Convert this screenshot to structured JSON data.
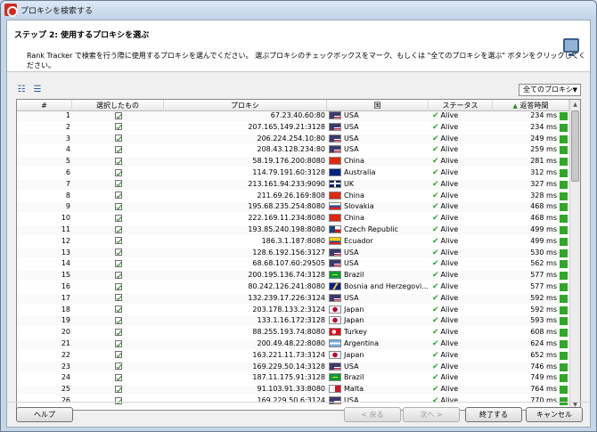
{
  "window": {
    "title": "プロキシを検索する"
  },
  "header": {
    "step_title": "ステップ 2: 使用するプロキシを選ぶ",
    "description": "Rank Tracker で検索を行う際に使用するプロキシを選んでください。 選ぶプロキシのチェックボックスをマーク、もしくは \"全てのプロキシを選ぶ\" ボタンをクリックしてください。"
  },
  "toolbar": {
    "filter_selected": "全てのプロキシ",
    "icons": [
      "select-all-icon",
      "deselect-all-icon"
    ]
  },
  "table": {
    "columns": [
      "#",
      "選択したもの",
      "プロキシ",
      "国",
      "ステータス",
      "返答時間"
    ],
    "sort_column": "返答時間",
    "rows": [
      {
        "num": "1",
        "proxy": "67.23.40.60:80",
        "country": "USA",
        "flag": "us",
        "status": "Alive",
        "resp": "234 ms"
      },
      {
        "num": "2",
        "proxy": "207.165.149.21:3128",
        "country": "USA",
        "flag": "us",
        "status": "Alive",
        "resp": "234 ms"
      },
      {
        "num": "3",
        "proxy": "206.224.254.10:80",
        "country": "USA",
        "flag": "us",
        "status": "Alive",
        "resp": "249 ms"
      },
      {
        "num": "4",
        "proxy": "208.43.128.234:80",
        "country": "USA",
        "flag": "us",
        "status": "Alive",
        "resp": "259 ms"
      },
      {
        "num": "5",
        "proxy": "58.19.176.200:8080",
        "country": "China",
        "flag": "cn",
        "status": "Alive",
        "resp": "281 ms"
      },
      {
        "num": "6",
        "proxy": "114.79.191.60:3128",
        "country": "Australia",
        "flag": "au",
        "status": "Alive",
        "resp": "312 ms"
      },
      {
        "num": "7",
        "proxy": "213.161.94.233:9090",
        "country": "UK",
        "flag": "uk",
        "status": "Alive",
        "resp": "327 ms"
      },
      {
        "num": "8",
        "proxy": "211.69.26.169:808",
        "country": "China",
        "flag": "cn",
        "status": "Alive",
        "resp": "328 ms"
      },
      {
        "num": "9",
        "proxy": "195.68.235.254:8080",
        "country": "Slovakia",
        "flag": "sk",
        "status": "Alive",
        "resp": "468 ms"
      },
      {
        "num": "10",
        "proxy": "222.169.11.234:8080",
        "country": "China",
        "flag": "cn",
        "status": "Alive",
        "resp": "468 ms"
      },
      {
        "num": "11",
        "proxy": "193.85.240.198:8080",
        "country": "Czech Republic",
        "flag": "cz",
        "status": "Alive",
        "resp": "499 ms"
      },
      {
        "num": "12",
        "proxy": "186.3.1.187:8080",
        "country": "Ecuador",
        "flag": "ec",
        "status": "Alive",
        "resp": "499 ms"
      },
      {
        "num": "13",
        "proxy": "128.6.192.156:3127",
        "country": "USA",
        "flag": "us",
        "status": "Alive",
        "resp": "530 ms"
      },
      {
        "num": "14",
        "proxy": "68.68.107.60:29505",
        "country": "USA",
        "flag": "us",
        "status": "Alive",
        "resp": "562 ms"
      },
      {
        "num": "15",
        "proxy": "200.195.136.74:3128",
        "country": "Brazil",
        "flag": "br",
        "status": "Alive",
        "resp": "577 ms"
      },
      {
        "num": "16",
        "proxy": "80.242.126.241:8080",
        "country": "Bosnia and Herzegovi...",
        "flag": "ba",
        "status": "Alive",
        "resp": "577 ms"
      },
      {
        "num": "17",
        "proxy": "132.239.17.226:3124",
        "country": "USA",
        "flag": "us",
        "status": "Alive",
        "resp": "592 ms"
      },
      {
        "num": "18",
        "proxy": "203.178.133.2:3124",
        "country": "Japan",
        "flag": "jp",
        "status": "Alive",
        "resp": "592 ms"
      },
      {
        "num": "19",
        "proxy": "133.1.16.172:3128",
        "country": "Japan",
        "flag": "jp",
        "status": "Alive",
        "resp": "593 ms"
      },
      {
        "num": "20",
        "proxy": "88.255.193.74:8080",
        "country": "Turkey",
        "flag": "tr",
        "status": "Alive",
        "resp": "608 ms"
      },
      {
        "num": "21",
        "proxy": "200.49.48.22:8080",
        "country": "Argentina",
        "flag": "ar",
        "status": "Alive",
        "resp": "624 ms"
      },
      {
        "num": "22",
        "proxy": "163.221.11.73:3124",
        "country": "Japan",
        "flag": "jp",
        "status": "Alive",
        "resp": "652 ms"
      },
      {
        "num": "23",
        "proxy": "169.229.50.14:3128",
        "country": "USA",
        "flag": "us",
        "status": "Alive",
        "resp": "746 ms"
      },
      {
        "num": "24",
        "proxy": "187.11.175.91:3128",
        "country": "Brazil",
        "flag": "br",
        "status": "Alive",
        "resp": "749 ms"
      },
      {
        "num": "25",
        "proxy": "91.103.91.33:8080",
        "country": "Malta",
        "flag": "mt",
        "status": "Alive",
        "resp": "764 ms"
      },
      {
        "num": "26",
        "proxy": "169.229.50.6:3124",
        "country": "USA",
        "flag": "us",
        "status": "Alive",
        "resp": "770 ms"
      }
    ]
  },
  "buttons": {
    "help": "ヘルプ",
    "back": "< 戻る",
    "next": "次へ >",
    "finish": "終了する",
    "cancel": "キャンセル"
  },
  "colors": {
    "alive": "#2ea52e",
    "bar": "#2fa826"
  }
}
